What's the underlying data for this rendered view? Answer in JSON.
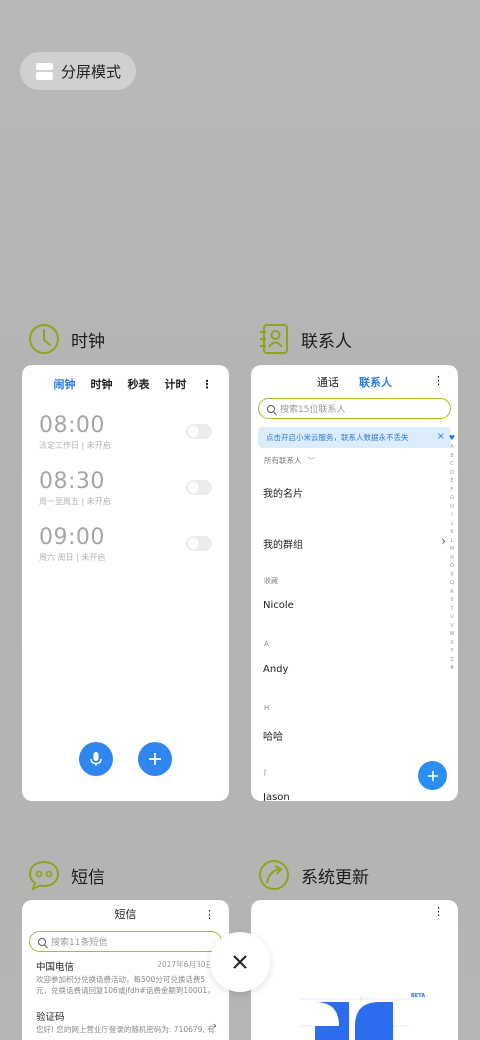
{
  "split_screen": {
    "label": "分屏模式"
  },
  "apps": {
    "clock": {
      "name": "时钟",
      "tabs": [
        "闹钟",
        "时钟",
        "秒表",
        "计时"
      ],
      "more": "⋮",
      "alarms": [
        {
          "time": "08:00",
          "detail": "法定工作日 | 未开启",
          "enabled": false
        },
        {
          "time": "08:30",
          "detail": "周一至周五 | 未开启",
          "enabled": false
        },
        {
          "time": "09:00",
          "detail": "周六 周日 | 未开启",
          "enabled": false
        }
      ]
    },
    "contacts": {
      "name": "联系人",
      "tabs": [
        "通话",
        "联系人"
      ],
      "more": "⋮",
      "search_placeholder": "搜索15位联系人",
      "banner": "点击开启小米云服务，联系人数据永不丢失",
      "filter": "所有联系人",
      "my_card": "我的名片",
      "my_groups": "我的群组",
      "sections": [
        {
          "header": "收藏",
          "name": "Nicole"
        },
        {
          "header": "A",
          "name": "Andy"
        },
        {
          "header": "H",
          "name": "哈哈"
        },
        {
          "header": "J",
          "name": "Jason"
        }
      ],
      "alphabet": [
        "A",
        "B",
        "C",
        "D",
        "E",
        "F",
        "G",
        "H",
        "I",
        "J",
        "K",
        "L",
        "M",
        "N",
        "O",
        "P",
        "Q",
        "R",
        "S",
        "T",
        "U",
        "V",
        "W",
        "X",
        "Y",
        "Z",
        "#"
      ]
    },
    "sms": {
      "name": "短信",
      "title": "短信",
      "more": "⋮",
      "search_placeholder": "搜索11条短信",
      "messages": [
        {
          "sender": "中国电信",
          "date": "2017年6月30日",
          "preview": "欢迎参加积分兑换话费活动，每500分可兑换话费5元，兑换话费请回复106或jfdh#话费金额到10001，回复..."
        },
        {
          "sender": "验证码",
          "date": "",
          "preview": "您好! 您的网上营业厅登录的随机密码为: 710679, 有..."
        }
      ]
    },
    "updater": {
      "name": "系统更新",
      "more": "⋮",
      "beta_badge": "BETA"
    }
  },
  "colors": {
    "accent": "#2c7be5",
    "icon_green": "#8aa61f",
    "background": "#b6b6b4"
  }
}
